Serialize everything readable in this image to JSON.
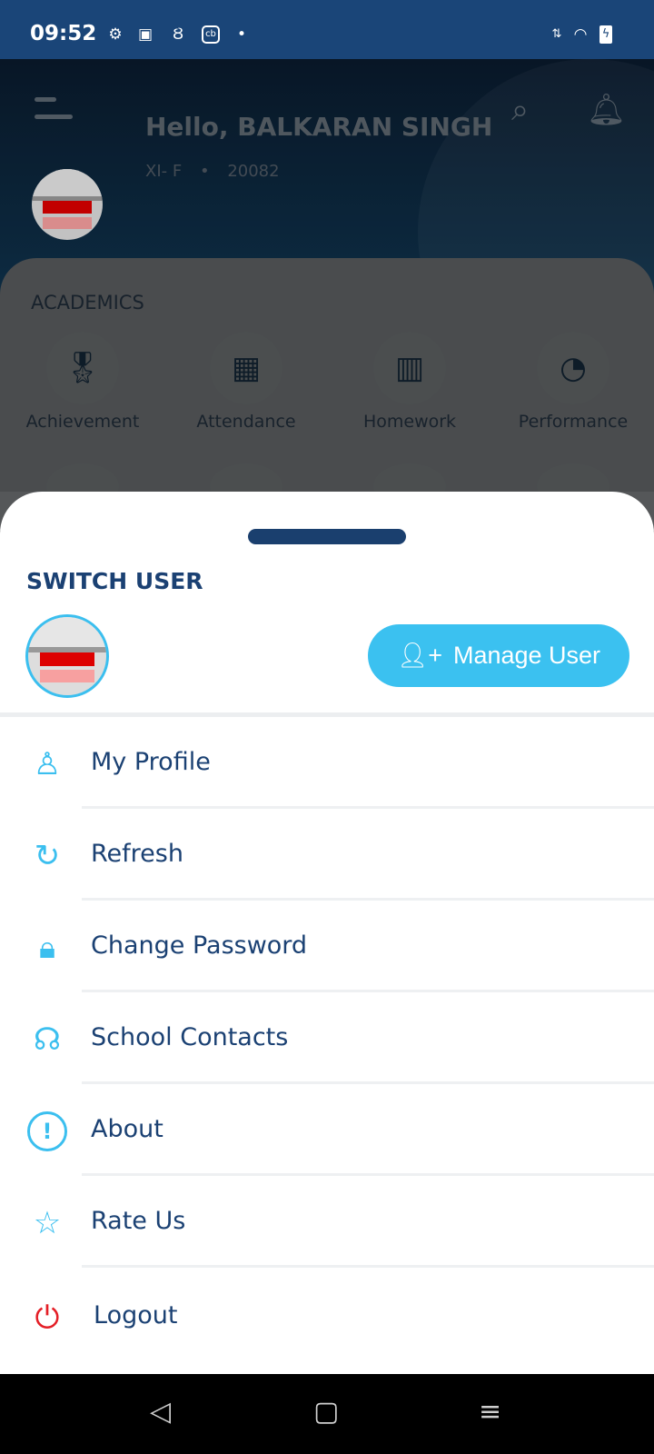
{
  "status_bar": {
    "time": "09:52",
    "icons": [
      "gear-icon",
      "chat-icon",
      "android-icon",
      "cb-app-icon",
      "dot-icon",
      "data-arrows-icon",
      "wifi-icon",
      "battery-charging-icon"
    ]
  },
  "header": {
    "greeting": "Hello, BALKARAN SINGH",
    "class": "XI- F",
    "separator": "•",
    "id": "20082"
  },
  "academics": {
    "title": "ACADEMICS",
    "tiles": [
      {
        "label": "Achievement",
        "icon": "medal-icon"
      },
      {
        "label": "Attendance",
        "icon": "calendar-user-icon"
      },
      {
        "label": "Homework",
        "icon": "book-icon"
      },
      {
        "label": "Performance",
        "icon": "gauge-icon"
      }
    ]
  },
  "sheet": {
    "title": "SWITCH USER",
    "manage_user": "Manage User",
    "items": [
      {
        "label": "My Profile",
        "icon": "user-icon"
      },
      {
        "label": "Refresh",
        "icon": "refresh-icon"
      },
      {
        "label": "Change Password",
        "icon": "lock-icon"
      },
      {
        "label": "School Contacts",
        "icon": "headset-icon"
      },
      {
        "label": "About",
        "icon": "info-icon"
      },
      {
        "label": "Rate Us",
        "icon": "star-icon"
      },
      {
        "label": "Logout",
        "icon": "power-icon"
      }
    ]
  },
  "colors": {
    "status_bar": "#1a4578",
    "accent": "#3bc1f0",
    "text": "#1b4173",
    "logout": "#e41e26"
  }
}
